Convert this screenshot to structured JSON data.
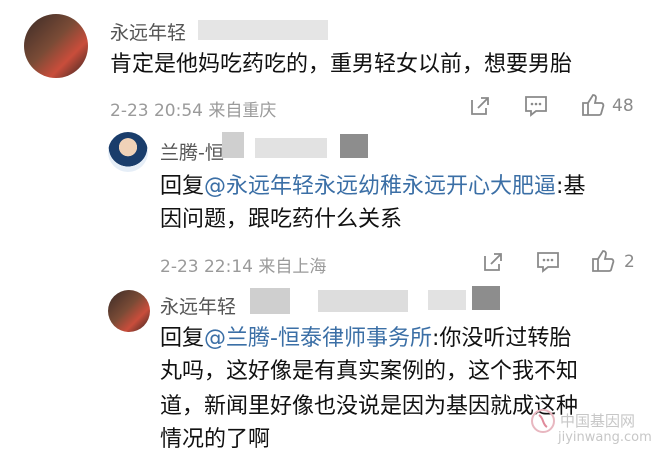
{
  "comments": [
    {
      "author": "永远年轻",
      "text_lines": [
        "肯定是他妈吃药吃的，重男轻女以前，想要男胎"
      ],
      "meta": "2-23 20:54  来自重庆",
      "likes": "48"
    },
    {
      "author": "兰腾-恒",
      "reply_prefix": "回复",
      "reply_to": "@永远年轻永远幼稚永远开心大肥逼",
      "text_first": ":基",
      "text_lines": [
        "因问题，跟吃药什么关系"
      ],
      "meta": "2-23 22:14  来自上海",
      "likes": "2"
    },
    {
      "author": "永远年轻",
      "reply_prefix": "回复",
      "reply_to": "@兰腾-恒泰律师事务所",
      "text_first": ":你没听过转胎",
      "text_lines": [
        "丸吗，这好像是有真实案例的，这个我不知",
        "道，新闻里好像也没说是因为基因就成这种",
        "情况的了啊"
      ]
    }
  ],
  "watermark": {
    "cn": "中国基因网",
    "url": "jiyinwang.com"
  }
}
